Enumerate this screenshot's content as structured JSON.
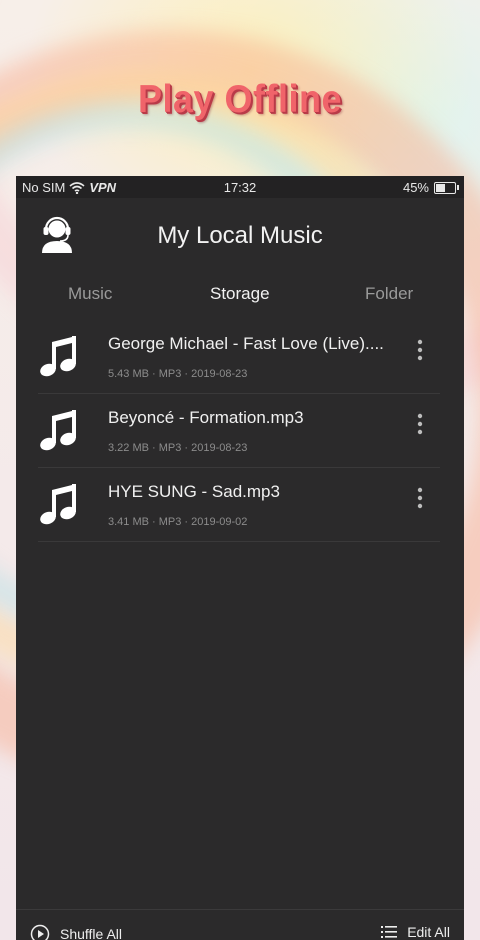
{
  "promo": {
    "title": "Play Offline"
  },
  "status_bar": {
    "carrier": "No SIM",
    "vpn": "VPN",
    "time": "17:32",
    "battery": "45%",
    "battery_level": 0.45,
    "icons": [
      "wifi-icon",
      "battery-icon"
    ]
  },
  "header": {
    "title": "My Local Music",
    "left_icon": "headset-agent-icon"
  },
  "tabs": [
    {
      "label": "Music",
      "active": false
    },
    {
      "label": "Storage",
      "active": true
    },
    {
      "label": "Folder",
      "active": false
    }
  ],
  "songs": [
    {
      "name": "George Michael - Fast Love (Live)....",
      "meta": "5.43 MB · MP3 · 2019-08-23",
      "icon": "music-note-icon"
    },
    {
      "name": "Beyoncé - Formation.mp3",
      "meta": "3.22 MB · MP3 · 2019-08-23",
      "icon": "music-note-icon"
    },
    {
      "name": "HYE SUNG - Sad.mp3",
      "meta": "3.41 MB · MP3 · 2019-09-02",
      "icon": "music-note-icon"
    }
  ],
  "bottom_bar": {
    "shuffle_label": "Shuffle All",
    "edit_label": "Edit All",
    "icons": [
      "play-circle-icon",
      "list-icon"
    ]
  },
  "colors": {
    "panel_bg": "#2b2a2b",
    "status_bg": "#232223",
    "promo_text": "#f0646a",
    "text_primary": "#f0f0f0",
    "text_secondary": "#8c8c8c",
    "tab_inactive": "#9a9a9a"
  }
}
